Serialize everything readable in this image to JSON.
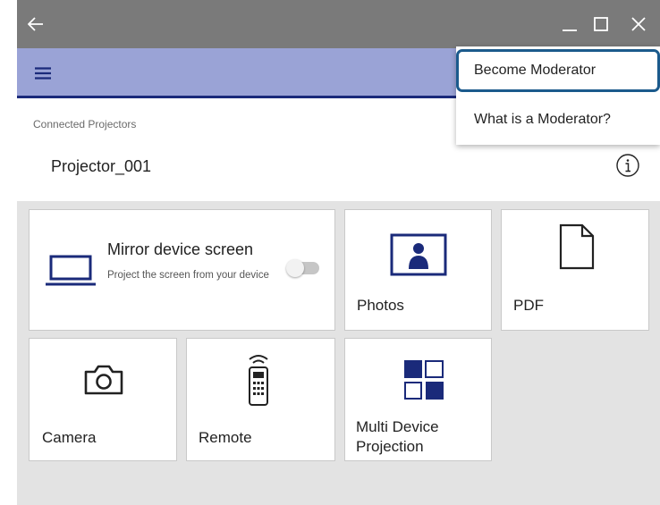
{
  "window": {
    "back_icon": "arrow-left-icon",
    "minimize_icon": "minimize-icon",
    "maximize_icon": "maximize-icon",
    "close_icon": "close-icon"
  },
  "appbar": {
    "menu_icon": "hamburger-menu-icon"
  },
  "projector": {
    "section_label": "Connected Projectors",
    "name": "Projector_001",
    "info_icon": "info-icon"
  },
  "tiles": {
    "mirror": {
      "title": "Mirror device screen",
      "description": "Project the screen from your device",
      "toggle_on": false
    },
    "photos": {
      "label": "Photos"
    },
    "pdf": {
      "label": "PDF"
    },
    "camera": {
      "label": "Camera"
    },
    "remote": {
      "label": "Remote"
    },
    "multi": {
      "label_line1": "Multi Device",
      "label_line2": "Projection"
    }
  },
  "menu": {
    "become_moderator": "Become Moderator",
    "what_is_moderator": "What is a Moderator?"
  },
  "colors": {
    "brand": "#1a2a7a",
    "appbar": "#9aa3d6",
    "titlebar": "#7a7a7a",
    "highlight": "#1b5a8c"
  }
}
